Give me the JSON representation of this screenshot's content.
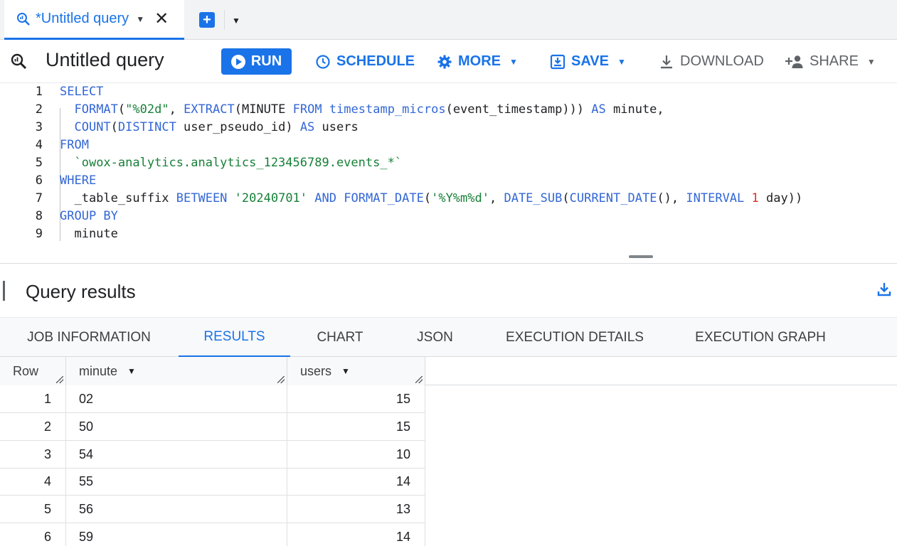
{
  "tab": {
    "label": "*Untitled query"
  },
  "toolbar": {
    "title": "Untitled query",
    "run": "RUN",
    "schedule": "SCHEDULE",
    "more": "MORE",
    "save": "SAVE",
    "download": "DOWNLOAD",
    "share": "SHARE"
  },
  "editor": {
    "lines": [
      {
        "n": "1",
        "parts": [
          [
            "kw",
            "SELECT"
          ]
        ]
      },
      {
        "n": "2",
        "parts": [
          [
            "",
            "  "
          ],
          [
            "fn",
            "FORMAT"
          ],
          [
            "",
            "("
          ],
          [
            "str",
            "\"%02d\""
          ],
          [
            "",
            ", "
          ],
          [
            "fn",
            "EXTRACT"
          ],
          [
            "",
            "(MINUTE "
          ],
          [
            "kw",
            "FROM"
          ],
          [
            "",
            " "
          ],
          [
            "fn",
            "timestamp_micros"
          ],
          [
            "",
            "(event_timestamp))) "
          ],
          [
            "kw",
            "AS"
          ],
          [
            "",
            " minute,"
          ]
        ]
      },
      {
        "n": "3",
        "parts": [
          [
            "",
            "  "
          ],
          [
            "fn",
            "COUNT"
          ],
          [
            "",
            "("
          ],
          [
            "kw",
            "DISTINCT"
          ],
          [
            "",
            " user_pseudo_id) "
          ],
          [
            "kw",
            "AS"
          ],
          [
            "",
            " users"
          ]
        ]
      },
      {
        "n": "4",
        "parts": [
          [
            "kw",
            "FROM"
          ]
        ]
      },
      {
        "n": "5",
        "parts": [
          [
            "",
            "  "
          ],
          [
            "str",
            "`owox-analytics.analytics_123456789.events_*`"
          ]
        ]
      },
      {
        "n": "6",
        "parts": [
          [
            "kw",
            "WHERE"
          ]
        ]
      },
      {
        "n": "7",
        "parts": [
          [
            "",
            "  _table_suffix "
          ],
          [
            "kw",
            "BETWEEN"
          ],
          [
            "",
            " "
          ],
          [
            "str",
            "'20240701'"
          ],
          [
            "",
            " "
          ],
          [
            "kw",
            "AND"
          ],
          [
            "",
            " "
          ],
          [
            "fn",
            "FORMAT_DATE"
          ],
          [
            "",
            "("
          ],
          [
            "str",
            "'%Y%m%d'"
          ],
          [
            "",
            ", "
          ],
          [
            "fn",
            "DATE_SUB"
          ],
          [
            "",
            "("
          ],
          [
            "fn",
            "CURRENT_DATE"
          ],
          [
            "",
            "(), "
          ],
          [
            "kw",
            "INTERVAL"
          ],
          [
            "",
            " "
          ],
          [
            "num",
            "1"
          ],
          [
            "",
            " day))"
          ]
        ]
      },
      {
        "n": "8",
        "parts": [
          [
            "kw",
            "GROUP BY"
          ]
        ]
      },
      {
        "n": "9",
        "parts": [
          [
            "",
            "  minute"
          ]
        ]
      }
    ]
  },
  "results": {
    "title": "Query results",
    "tabs": [
      "JOB INFORMATION",
      "RESULTS",
      "CHART",
      "JSON",
      "EXECUTION DETAILS",
      "EXECUTION GRAPH"
    ],
    "active_tab": "RESULTS",
    "columns": [
      "Row",
      "minute",
      "users"
    ],
    "rows": [
      [
        "1",
        "02",
        "15"
      ],
      [
        "2",
        "50",
        "15"
      ],
      [
        "3",
        "54",
        "10"
      ],
      [
        "4",
        "55",
        "14"
      ],
      [
        "5",
        "56",
        "13"
      ],
      [
        "6",
        "59",
        "14"
      ]
    ]
  },
  "colors": {
    "accent": "#1a73e8",
    "keyword": "#3367d6",
    "string": "#188038",
    "number": "#d93025"
  },
  "icons": [
    "query-icon",
    "close-icon",
    "add-tab-icon",
    "play-icon",
    "clock-icon",
    "gear-icon",
    "save-icon",
    "download-icon",
    "person-add-icon"
  ]
}
